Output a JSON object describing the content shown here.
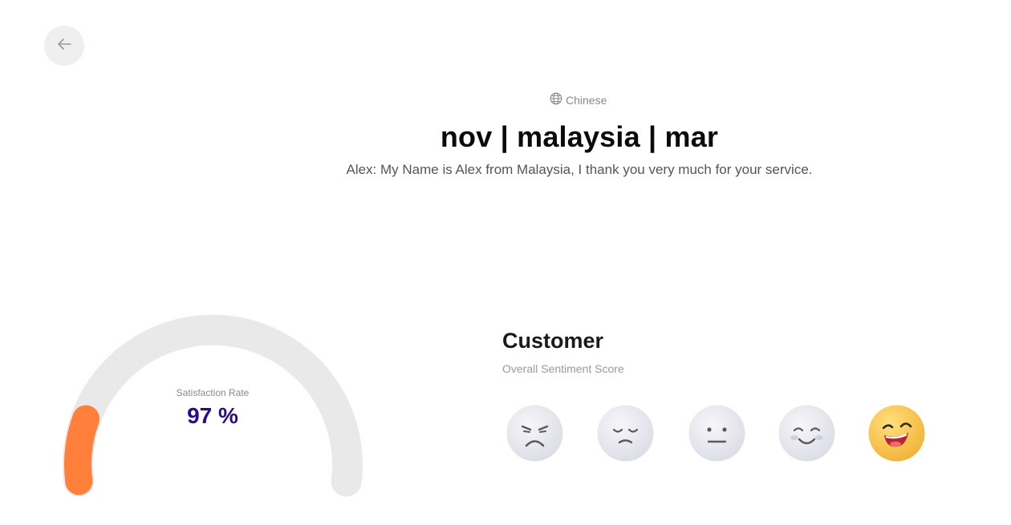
{
  "nav": {
    "back_icon": "arrow-left-icon"
  },
  "header": {
    "language": "Chinese",
    "language_icon": "globe-icon",
    "title": "nov | malaysia | mar",
    "subtitle": "Alex: My Name is Alex from Malaysia, I thank you very much for your service."
  },
  "gauge": {
    "label": "Satisfaction Rate",
    "value_text": "97 %",
    "fill_color": "#ff7f3b",
    "track_color": "#e9e9e9"
  },
  "customer": {
    "title": "Customer",
    "subtitle": "Overall Sentiment Score",
    "faces": [
      {
        "name": "angry-face-icon",
        "selected": false
      },
      {
        "name": "sad-face-icon",
        "selected": false
      },
      {
        "name": "neutral-face-icon",
        "selected": false
      },
      {
        "name": "smiling-face-icon",
        "selected": false
      },
      {
        "name": "happy-face-icon",
        "selected": true
      }
    ],
    "selected_color": "#f7c948"
  }
}
